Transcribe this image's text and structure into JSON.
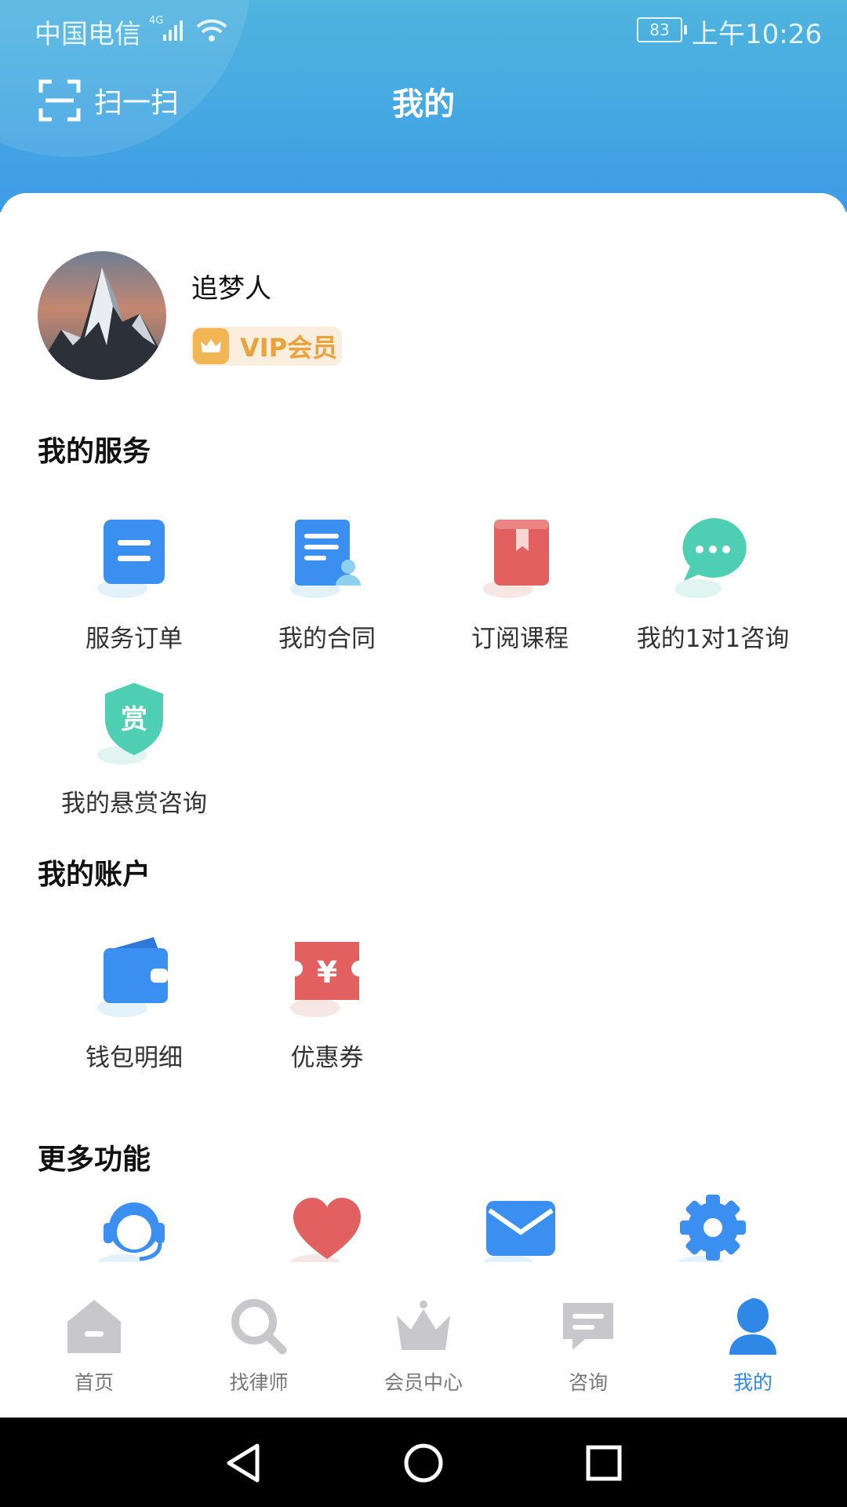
{
  "status_bar": {
    "carrier": "中国电信",
    "network": "4G",
    "battery": "83",
    "time": "上午10:26"
  },
  "header": {
    "scan_label": "扫一扫",
    "title": "我的"
  },
  "profile": {
    "name": "追梦人",
    "badge": "VIP会员"
  },
  "sections": {
    "services": {
      "title": "我的服务",
      "items": [
        {
          "label": "服务订单",
          "icon": "order-icon"
        },
        {
          "label": "我的合同",
          "icon": "contract-icon"
        },
        {
          "label": "订阅课程",
          "icon": "course-icon"
        },
        {
          "label": "我的1对1咨询",
          "icon": "chat-icon"
        },
        {
          "label": "我的悬赏咨询",
          "icon": "reward-icon",
          "icon_text": "赏"
        }
      ]
    },
    "account": {
      "title": "我的账户",
      "items": [
        {
          "label": "钱包明细",
          "icon": "wallet-icon"
        },
        {
          "label": "优惠券",
          "icon": "coupon-icon",
          "icon_text": "¥"
        }
      ]
    },
    "more": {
      "title": "更多功能",
      "icons": [
        "customer-service-icon",
        "heart-icon",
        "mail-icon",
        "gear-icon"
      ]
    }
  },
  "tabbar": [
    {
      "label": "首页",
      "icon": "home-icon"
    },
    {
      "label": "找律师",
      "icon": "search-icon"
    },
    {
      "label": "会员中心",
      "icon": "crown-icon"
    },
    {
      "label": "咨询",
      "icon": "message-icon"
    },
    {
      "label": "我的",
      "icon": "user-icon",
      "active": true
    }
  ],
  "colors": {
    "header_top": "#4fb4de",
    "header_bottom": "#3e9ae6",
    "blue": "#3b8ff0",
    "red": "#e2605f",
    "teal": "#4ecfb3",
    "vip_gold": "#e9a33a",
    "tab_active": "#2f88e6",
    "tab_inactive": "#c8c8cc"
  }
}
